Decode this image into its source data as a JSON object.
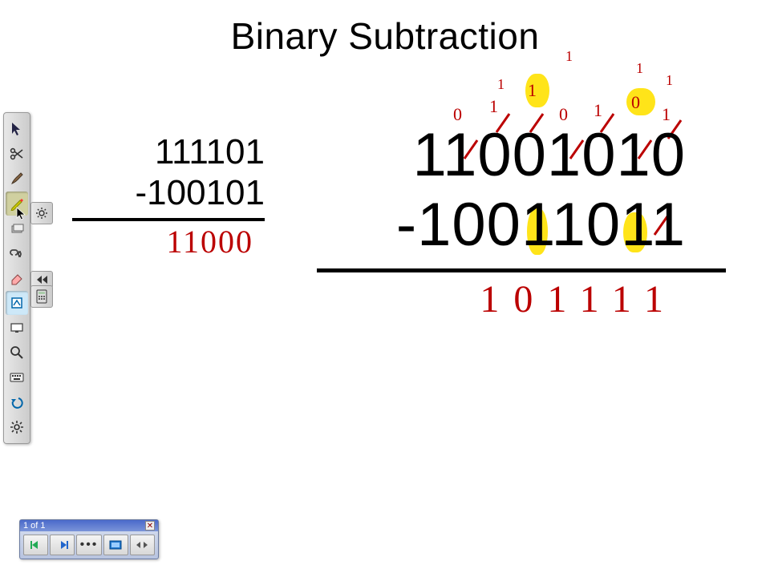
{
  "title": "Binary Subtraction",
  "pager": {
    "label": "1 of 1"
  },
  "problem1": {
    "minuend": "111101",
    "subtrahend": "-100101",
    "result": "11000"
  },
  "problem2": {
    "minuend": "11001010",
    "subtrahend": "-10011011",
    "result": "101111",
    "scratch_row": [
      "0",
      "1",
      "1",
      "0",
      "1",
      "0",
      "1"
    ],
    "carry_row": [
      "",
      "1",
      "",
      "",
      "1",
      "",
      "1",
      "1"
    ]
  },
  "tools": {
    "pointer": "pointer",
    "scissors": "scissors",
    "brush": "brush",
    "pen": "pen",
    "stack": "stack",
    "link": "link",
    "eraser": "eraser",
    "highlighter": "highlighter",
    "screen": "screen",
    "zoom": "zoom",
    "keyboard": "keyboard",
    "undo": "undo",
    "settings": "settings"
  },
  "nav": {
    "prev": "prev",
    "next": "next",
    "menu": "menu",
    "fullscreen": "fullscreen",
    "fit": "fit"
  }
}
